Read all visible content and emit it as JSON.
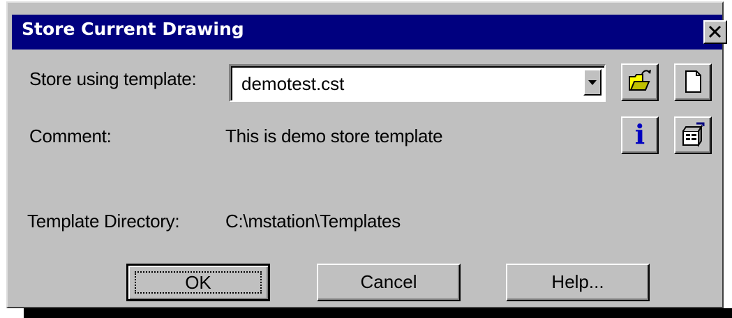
{
  "window": {
    "title": "Store Current Drawing",
    "close_glyph": "✕"
  },
  "template": {
    "label": "Store using template:",
    "value": "demotest.cst",
    "dropdown_icon": "chevron-down-icon"
  },
  "comment": {
    "label": "Comment:",
    "value": "This is demo store template"
  },
  "directory": {
    "label": "Template Directory:",
    "value": "C:\\mstation\\Templates"
  },
  "tool_buttons": {
    "open": "open-folder-icon",
    "new": "new-document-icon",
    "info": "info-icon",
    "properties": "properties-icon",
    "info_glyph": "i"
  },
  "buttons": {
    "ok": "OK",
    "cancel": "Cancel",
    "help": "Help..."
  },
  "colors": {
    "titlebar": "#00007f",
    "face": "#c0c0c0",
    "info_blue": "#0000c0",
    "folder_yellow": "#ffff00"
  }
}
